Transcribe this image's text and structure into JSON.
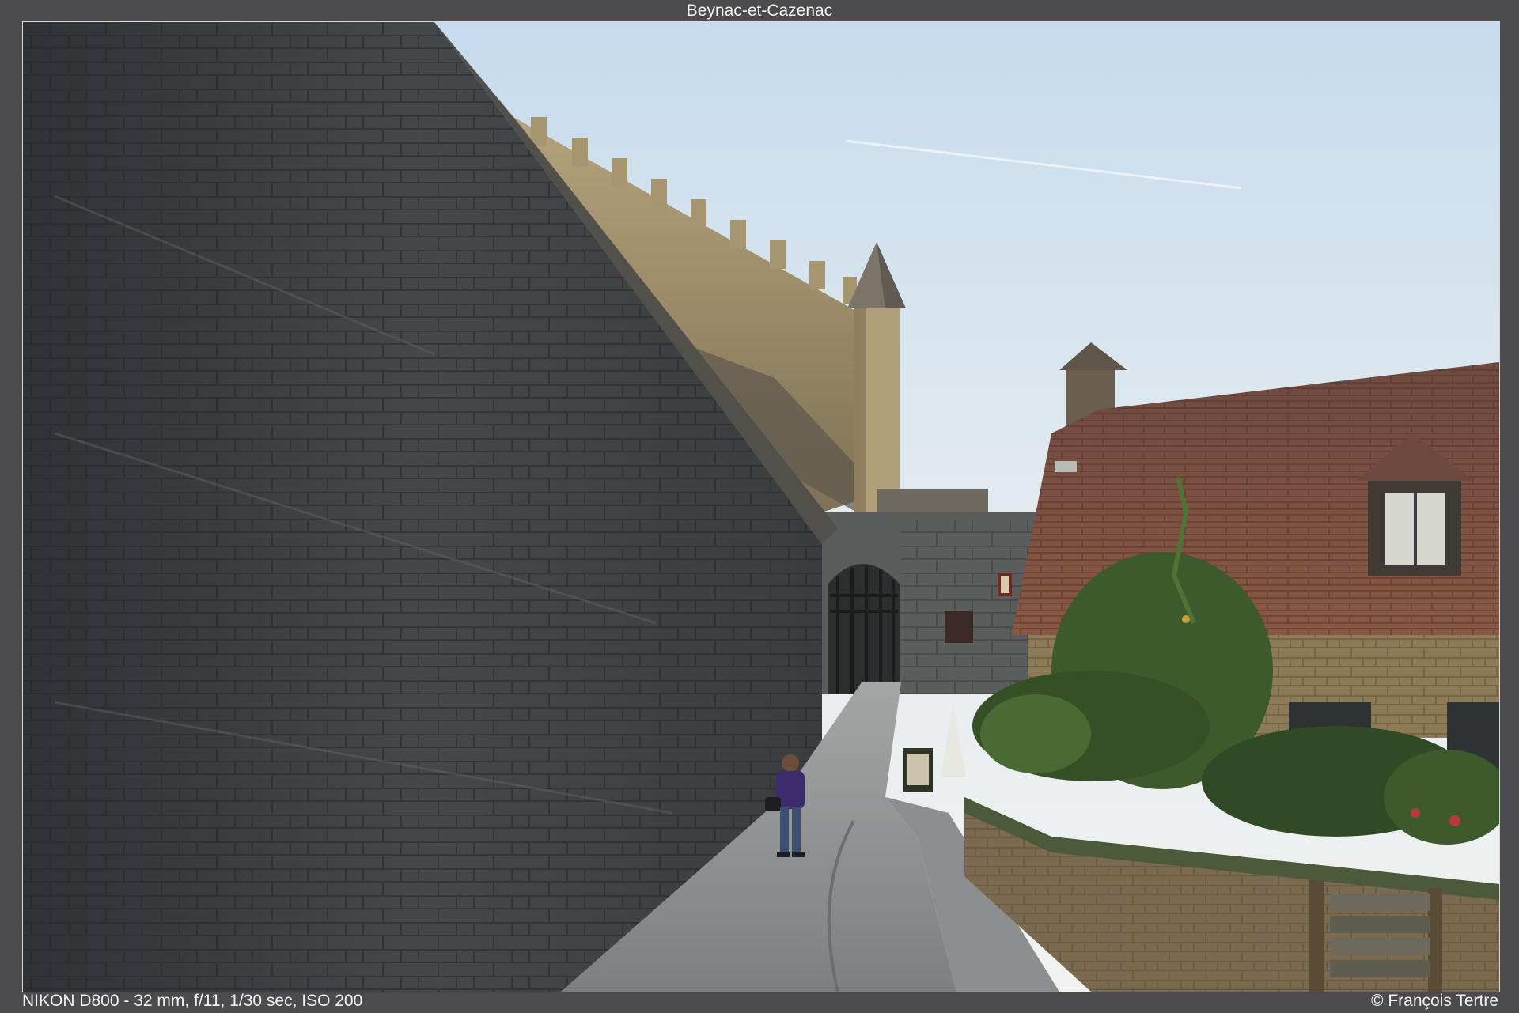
{
  "title": "Beynac-et-Cazenac",
  "exif": "NIKON D800 - 32 mm, f/11, 1/30 sec, ISO 200",
  "credit": "© François Tertre",
  "colors": {
    "sky_top": "#c9dced",
    "sky_bottom": "#eef2f4",
    "wall_dark": "#3d4044",
    "castle_sand": "#a3916b",
    "roof_red": "#7a4b3e",
    "path_grey": "#8e9092",
    "foliage": "#3d5a2c"
  }
}
